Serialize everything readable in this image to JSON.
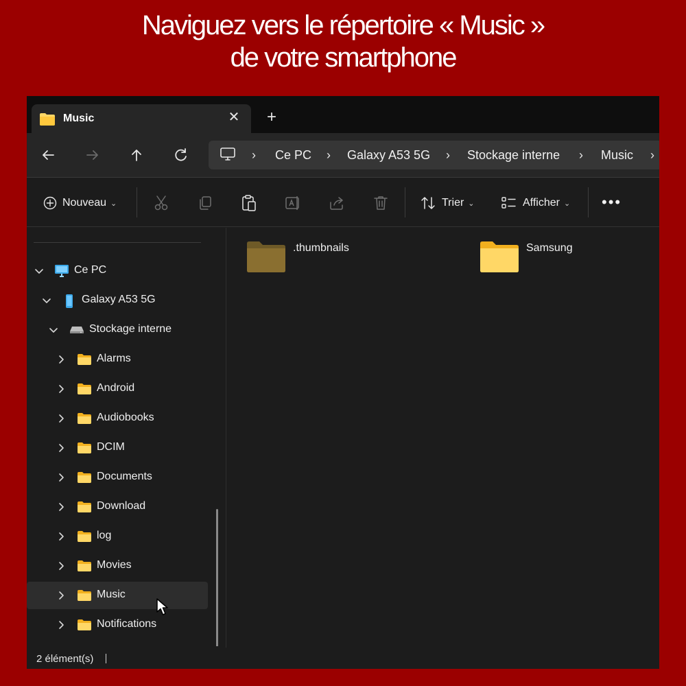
{
  "headline": {
    "line1": "Naviguez vers le répertoire « Music »",
    "line2": "de votre smartphone"
  },
  "tab": {
    "title": "Music",
    "close_glyph": "✕",
    "new_tab_glyph": "+"
  },
  "nav": {
    "back_icon": "back-arrow-icon",
    "forward_icon": "forward-arrow-icon",
    "up_icon": "up-arrow-icon",
    "refresh_icon": "refresh-icon"
  },
  "breadcrumb": {
    "items": [
      "Ce PC",
      "Galaxy A53 5G",
      "Stockage interne",
      "Music"
    ],
    "separator": "›"
  },
  "commands": {
    "new_label": "Nouveau",
    "sort_label": "Trier",
    "view_label": "Afficher",
    "more_glyph": "•••",
    "disabled_icons": [
      "cut-icon",
      "copy-icon",
      "paste-icon",
      "rename-icon",
      "share-icon",
      "delete-icon"
    ]
  },
  "sidebar": {
    "pc_label": "Ce PC",
    "device_label": "Galaxy A53 5G",
    "storage_label": "Stockage interne",
    "folders": [
      "Alarms",
      "Android",
      "Audiobooks",
      "DCIM",
      "Documents",
      "Download",
      "log",
      "Movies",
      "Music",
      "Notifications"
    ],
    "selected": "Music"
  },
  "content": {
    "items": [
      {
        "name": ".thumbnails",
        "hidden": true
      },
      {
        "name": "Samsung",
        "hidden": false
      }
    ]
  },
  "status": {
    "count": "2 élément(s)"
  },
  "colors": {
    "frame": "#9b0000",
    "window": "#1c1c1c",
    "folder": "#ffd766",
    "folder_hidden": "#8a6f30",
    "pc_icon": "#3aa7e8"
  }
}
